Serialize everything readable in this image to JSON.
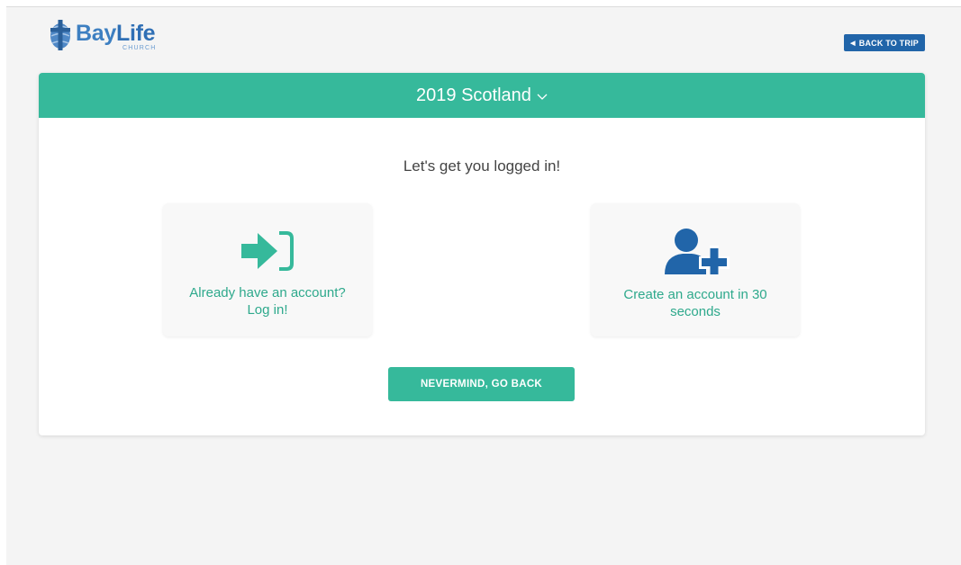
{
  "brand": {
    "name_part1": "Bay",
    "name_part2": "Life",
    "subtitle": "CHURCH",
    "logo_icon": "cross-globe-icon",
    "colors": {
      "blue": "#3d7fc1",
      "dark_blue": "#2165a9"
    }
  },
  "header": {
    "back_button_label": "BACK TO TRIP",
    "back_icon": "chevron-left-icon"
  },
  "trip": {
    "title": "2019 Scotland",
    "dropdown_icon": "chevron-down-icon",
    "accent_color": "#36b99b"
  },
  "login": {
    "prompt": "Let's get you logged in!",
    "options": [
      {
        "label": "Already have an account? Log in!",
        "icon": "sign-in-icon"
      },
      {
        "label": "Create an account in 30 seconds",
        "icon": "user-plus-icon"
      }
    ],
    "go_back_label": "NEVERMIND, GO BACK"
  }
}
